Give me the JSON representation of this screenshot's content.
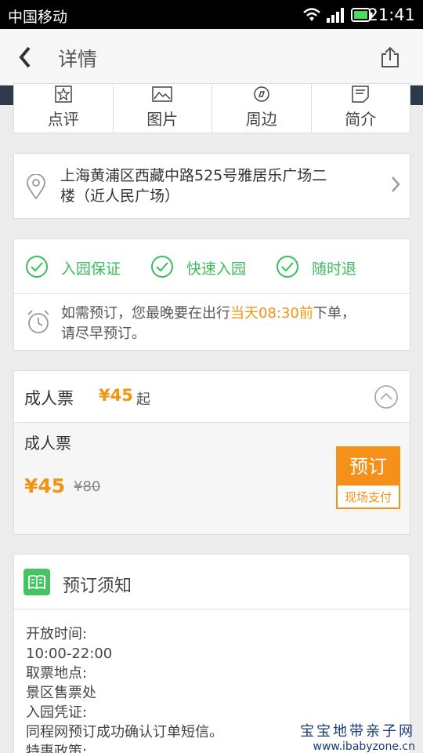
{
  "status_bar": {
    "carrier": "中国移动",
    "time": "21:41"
  },
  "nav": {
    "title": "详情"
  },
  "tabs": [
    {
      "label": "点评",
      "icon": "star-icon"
    },
    {
      "label": "图片",
      "icon": "image-icon"
    },
    {
      "label": "周边",
      "icon": "compass-icon"
    },
    {
      "label": "简介",
      "icon": "document-icon"
    }
  ],
  "address": {
    "line1": "上海黄浦区西藏中路525号雅居乐广场二",
    "line2": "楼（近人民广场）"
  },
  "guarantees": [
    {
      "label": "入园保证"
    },
    {
      "label": "快速入园"
    },
    {
      "label": "随时退"
    }
  ],
  "notice": {
    "prefix": "如需预订，您最晚要在出行",
    "highlight": "当天08:30前",
    "suffix": "下单，",
    "line2": "请尽早预订。"
  },
  "ticket": {
    "title": "成人票",
    "from_price": "¥45",
    "from_suffix": "起",
    "item_name": "成人票",
    "price": "¥45",
    "original_price": "¥80",
    "book_label": "预订",
    "pay_label": "现场支付"
  },
  "booking_notice": {
    "title": "预订须知",
    "lines": [
      "开放时间:",
      "10:00-22:00",
      "取票地点:",
      "景区售票处",
      "入园凭证:",
      "同程网预订成功确认订单短信。",
      "特惠政策:"
    ]
  },
  "watermark": {
    "line1": "宝宝地带亲子网",
    "line2": "www.ibabyzone.cn"
  },
  "colors": {
    "accent": "#f29411",
    "green": "#3cbc5c"
  }
}
